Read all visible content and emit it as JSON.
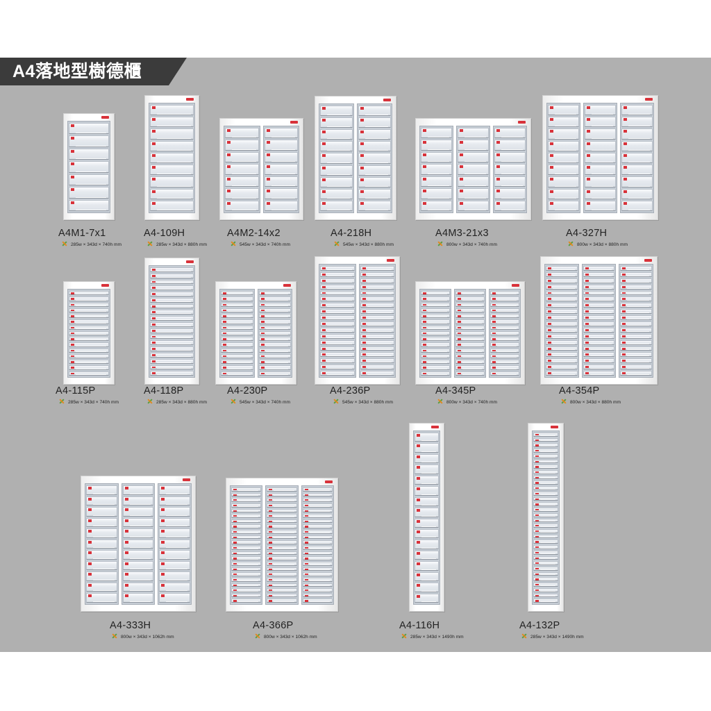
{
  "page": {
    "title": "A4落地型樹德櫃",
    "colors": {
      "panel": "#b0b0b0",
      "title_bar": "#3b3b3b",
      "accent_tag": "#d8323a"
    },
    "icon": "dimension-bullet-icon"
  },
  "products": [
    {
      "model": "A4M1-7x1",
      "dims": "285w × 343d × 740h mm",
      "columns": 1,
      "drawers": 7
    },
    {
      "model": "A4-109H",
      "dims": "285w × 343d × 880h mm",
      "columns": 1,
      "drawers": 9
    },
    {
      "model": "A4M2-14x2",
      "dims": "545w × 343d × 740h mm",
      "columns": 2,
      "drawers": 7
    },
    {
      "model": "A4-218H",
      "dims": "545w × 343d × 880h mm",
      "columns": 2,
      "drawers": 9
    },
    {
      "model": "A4M3-21x3",
      "dims": "800w × 343d × 740h mm",
      "columns": 3,
      "drawers": 7
    },
    {
      "model": "A4-327H",
      "dims": "800w × 343d × 880h mm",
      "columns": 3,
      "drawers": 9
    },
    {
      "model": "A4-115P",
      "dims": "285w × 343d × 740h mm",
      "columns": 1,
      "drawers": 15
    },
    {
      "model": "A4-118P",
      "dims": "285w × 343d × 880h mm",
      "columns": 1,
      "drawers": 18
    },
    {
      "model": "A4-230P",
      "dims": "545w × 343d × 740h mm",
      "columns": 2,
      "drawers": 15
    },
    {
      "model": "A4-236P",
      "dims": "545w × 343d × 880h mm",
      "columns": 2,
      "drawers": 18
    },
    {
      "model": "A4-345P",
      "dims": "800w × 343d × 740h mm",
      "columns": 3,
      "drawers": 15
    },
    {
      "model": "A4-354P",
      "dims": "800w × 343d × 880h mm",
      "columns": 3,
      "drawers": 18
    },
    {
      "model": "A4-333H",
      "dims": "800w × 343d × 1062h mm",
      "columns": 3,
      "drawers": 11
    },
    {
      "model": "A4-366P",
      "dims": "800w × 343d × 1062h mm",
      "columns": 3,
      "drawers": 22
    },
    {
      "model": "A4-116H",
      "dims": "285w × 343d × 1490h mm",
      "columns": 1,
      "drawers": 16
    },
    {
      "model": "A4-132P",
      "dims": "285w × 343d × 1490h mm",
      "columns": 1,
      "drawers": 32
    }
  ]
}
